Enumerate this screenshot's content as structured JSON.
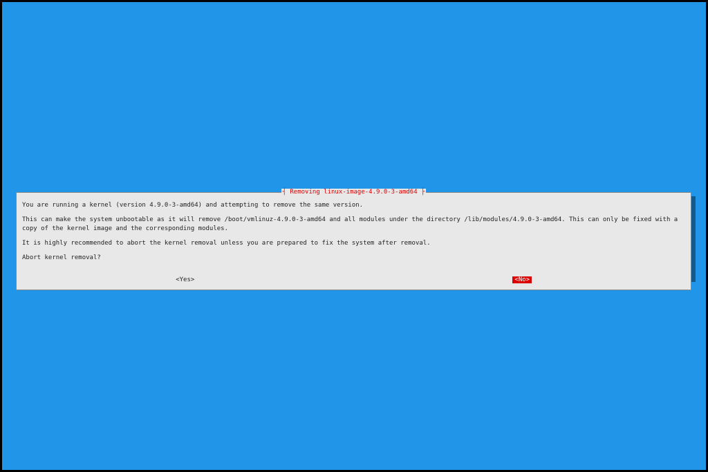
{
  "dialog": {
    "title": "┤ Removing linux-image-4.9.0-3-amd64 ├",
    "paragraphs": {
      "p1": "You are running a kernel (version 4.9.0-3-amd64) and attempting to remove the same version.",
      "p2": "This can make the system unbootable as it will remove /boot/vmlinuz-4.9.0-3-amd64 and all modules under the directory /lib/modules/4.9.0-3-amd64. This can only be fixed with a copy of the kernel image and the corresponding modules.",
      "p3": "It is highly recommended to abort the kernel removal unless you are prepared to fix the system after removal.",
      "p4": "Abort kernel removal?"
    },
    "buttons": {
      "yes": "<Yes>",
      "no": "<No>"
    }
  }
}
